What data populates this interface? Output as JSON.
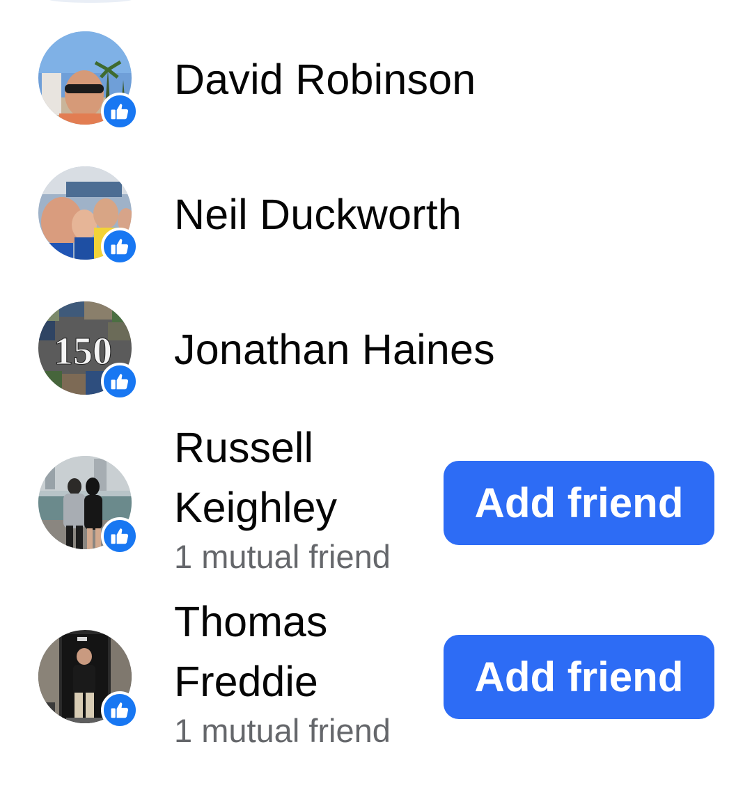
{
  "reactors": [
    {
      "name": "David Robinson",
      "reaction_icon": "like-icon",
      "has_add_button": false
    },
    {
      "name": "Neil Duckworth",
      "reaction_icon": "like-icon",
      "has_add_button": false
    },
    {
      "name": "Jonathan Haines",
      "reaction_icon": "like-icon",
      "has_add_button": false,
      "avatar_text": "150"
    },
    {
      "name_line1": "Russell",
      "name_line2": "Keighley",
      "mutual": "1 mutual friend",
      "reaction_icon": "like-icon",
      "has_add_button": true,
      "button_label": "Add friend"
    },
    {
      "name_line1": "Thomas",
      "name_line2": "Freddie",
      "mutual": "1 mutual friend",
      "reaction_icon": "like-icon",
      "has_add_button": true,
      "button_label": "Add friend"
    }
  ],
  "colors": {
    "like_badge": "#1877f2",
    "add_button": "#2d6cf5",
    "name_text": "#050505",
    "secondary_text": "#65676b"
  }
}
